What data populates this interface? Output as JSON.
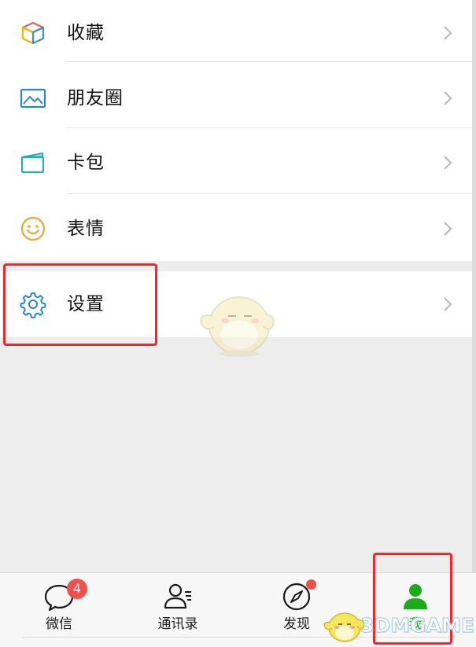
{
  "menu": {
    "items": [
      {
        "label": "收藏",
        "icon": "favorites-cube-icon"
      },
      {
        "label": "朋友圈",
        "icon": "moments-photo-icon"
      },
      {
        "label": "卡包",
        "icon": "card-wallet-icon"
      },
      {
        "label": "表情",
        "icon": "sticker-smiley-icon"
      },
      {
        "label": "设置",
        "icon": "settings-gear-icon"
      }
    ]
  },
  "tabbar": {
    "tabs": [
      {
        "label": "微信",
        "icon": "chat-bubble-icon",
        "badge": "4"
      },
      {
        "label": "通讯录",
        "icon": "contacts-icon"
      },
      {
        "label": "发现",
        "icon": "compass-icon",
        "dot": true
      },
      {
        "label": "我",
        "icon": "me-person-icon",
        "active": true
      }
    ]
  },
  "watermark": "3DMGAME",
  "colors": {
    "active_tab": "#1aad19",
    "badge": "#f0504c",
    "highlight_box": "#ff2222",
    "background": "#ededed"
  }
}
